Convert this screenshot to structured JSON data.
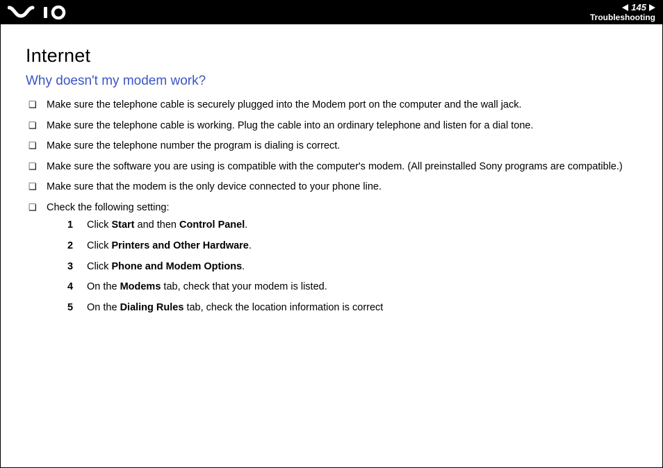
{
  "header": {
    "page_number": "145",
    "section": "Troubleshooting",
    "logo_alt": "VAIO"
  },
  "main": {
    "title": "Internet",
    "subtitle": "Why doesn't my modem work?",
    "bullets": [
      "Make sure the telephone cable is securely plugged into the Modem port on the computer and the wall jack.",
      "Make sure the telephone cable is working. Plug the cable into an ordinary telephone and listen for a dial tone.",
      "Make sure the telephone number the program is dialing is correct.",
      "Make sure the software you are using is compatible with the computer's modem. (All preinstalled Sony programs are compatible.)",
      "Make sure that the modem is the only device connected to your phone line.",
      "Check the following setting:"
    ],
    "steps": [
      {
        "pre": "Click ",
        "b1": "Start",
        "mid": " and then ",
        "b2": "Control Panel",
        "post": "."
      },
      {
        "pre": "Click ",
        "b1": "Printers and Other Hardware",
        "mid": "",
        "b2": "",
        "post": "."
      },
      {
        "pre": "Click ",
        "b1": "Phone and Modem Options",
        "mid": "",
        "b2": "",
        "post": "."
      },
      {
        "pre": "On the ",
        "b1": "Modems",
        "mid": " tab, check that your modem is listed.",
        "b2": "",
        "post": ""
      },
      {
        "pre": "On the ",
        "b1": "Dialing Rules",
        "mid": " tab, check the location information is correct",
        "b2": "",
        "post": ""
      }
    ]
  }
}
